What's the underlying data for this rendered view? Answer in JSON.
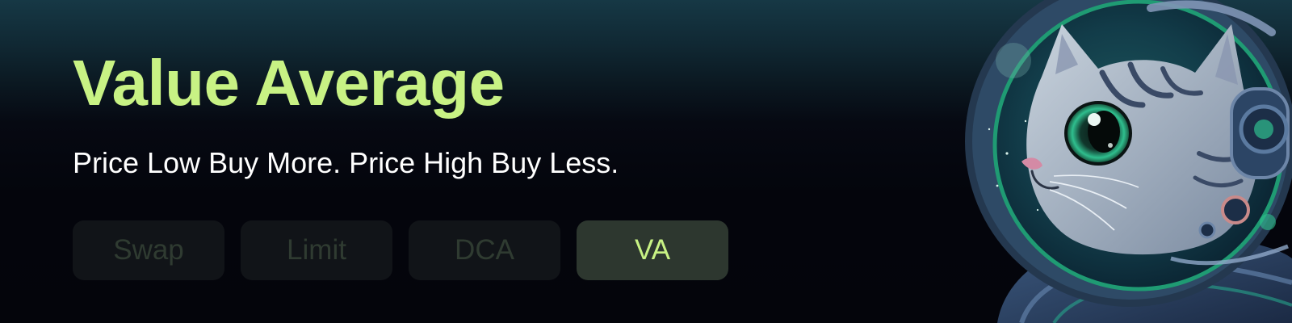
{
  "banner": {
    "title": "Value Average",
    "subtitle": "Price Low Buy More. Price High Buy Less."
  },
  "tabs": [
    {
      "label": "Swap",
      "active": false
    },
    {
      "label": "Limit",
      "active": false
    },
    {
      "label": "DCA",
      "active": false
    },
    {
      "label": "VA",
      "active": true
    }
  ],
  "illustration": {
    "icon": "astronaut-cat-icon"
  },
  "colors": {
    "title": "#c8f284",
    "subtitle": "#ffffff",
    "tab_inactive_text": "#2f3b31",
    "tab_active_text": "#c8f284",
    "tab_inactive_bg": "#111418",
    "tab_active_bg": "#2d372f"
  }
}
